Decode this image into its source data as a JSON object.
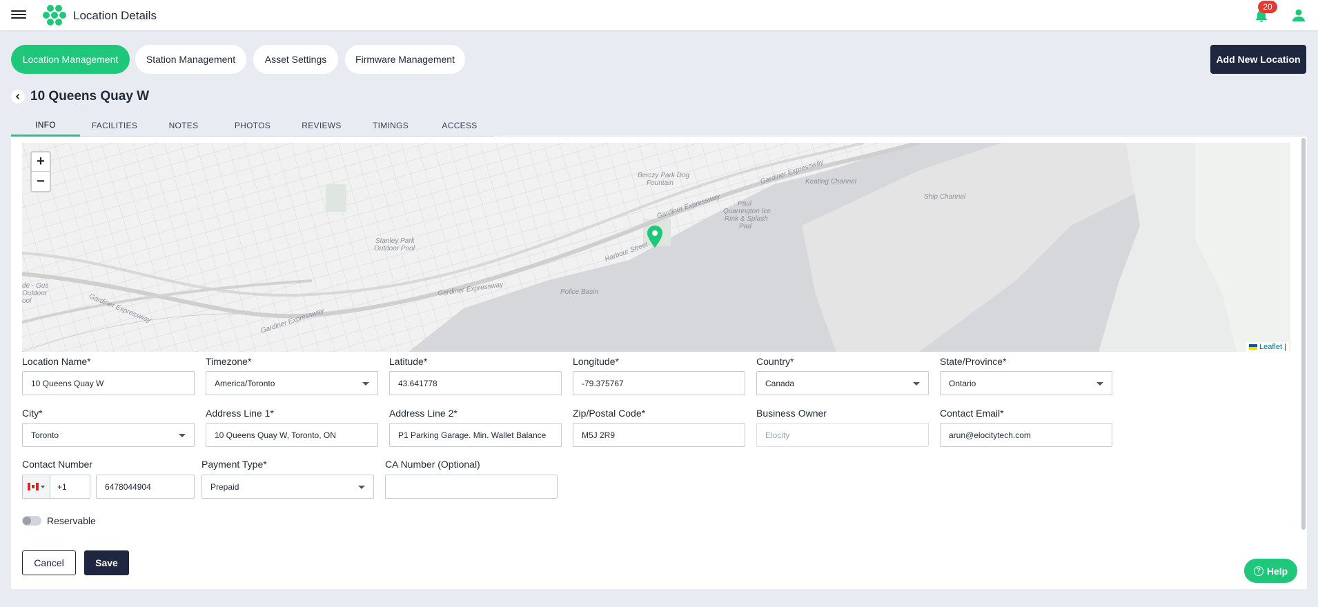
{
  "app": {
    "title": "Location Details",
    "notification_count": "20"
  },
  "top_tabs": [
    {
      "label": "Location Management",
      "active": true
    },
    {
      "label": "Station Management"
    },
    {
      "label": "Asset Settings"
    },
    {
      "label": "Firmware Management"
    }
  ],
  "add_button": "Add New Location",
  "page_title": "10 Queens Quay W",
  "sub_tabs": [
    "INFO",
    "FACILITIES",
    "NOTES",
    "PHOTOS",
    "REVIEWS",
    "TIMINGS",
    "ACCESS"
  ],
  "map": {
    "zoom_in": "+",
    "zoom_out": "−",
    "attribution": "Leaflet",
    "attribution_sep": "|",
    "labels": {
      "berczy": "Berczy Park Dog",
      "berczy2": "Fountain",
      "keating": "Keating Channel",
      "ship": "Ship Channel",
      "paul": "Paul",
      "paul2": "Quarrington Ice",
      "paul3": "Rink & Splash",
      "paul4": "Pad",
      "stanley": "Stanley Park",
      "stanley2": "Outdoor Pool",
      "gardiner1": "Gardiner Expressway",
      "gardiner2": "Gardiner Expressway",
      "gardiner3": "Gardiner Expressway",
      "gardiner4": "Gardiner Expressway",
      "gardiner5": "Gardiner Expressway",
      "harbour": "Harbour Street",
      "police": "Police Basin",
      "gus1": "de - Gus",
      "gus2": "Outdoor",
      "gus3": "ool"
    }
  },
  "form": {
    "location_name": {
      "label": "Location Name*",
      "value": "10 Queens Quay W"
    },
    "timezone": {
      "label": "Timezone*",
      "value": "America/Toronto"
    },
    "latitude": {
      "label": "Latitude*",
      "value": "43.641778"
    },
    "longitude": {
      "label": "Longitude*",
      "value": "-79.375767"
    },
    "country": {
      "label": "Country*",
      "value": "Canada"
    },
    "state": {
      "label": "State/Province*",
      "value": "Ontario"
    },
    "city": {
      "label": "City*",
      "value": "Toronto"
    },
    "address1": {
      "label": "Address Line 1*",
      "value": "10 Queens Quay W, Toronto, ON"
    },
    "address2": {
      "label": "Address Line 2*",
      "value": "P1 Parking Garage. Min. Wallet Balance"
    },
    "zip": {
      "label": "Zip/Postal Code*",
      "value": "M5J 2R9"
    },
    "business_owner": {
      "label": "Business Owner",
      "placeholder": "Elocity"
    },
    "contact_email": {
      "label": "Contact Email*",
      "value": "arun@elocitytech.com"
    },
    "contact_number": {
      "label": "Contact Number",
      "country_code": "+1",
      "value": "6478044904"
    },
    "payment_type": {
      "label": "Payment Type*",
      "value": "Prepaid"
    },
    "ca_number": {
      "label": "CA Number (Optional)",
      "value": ""
    },
    "reservable": {
      "label": "Reservable",
      "on": false
    }
  },
  "buttons": {
    "cancel": "Cancel",
    "save": "Save",
    "help": "Help",
    "help_glyph": "?"
  },
  "colors": {
    "accent": "#1ec779",
    "dark": "#1e2640",
    "badge": "#e53935"
  }
}
